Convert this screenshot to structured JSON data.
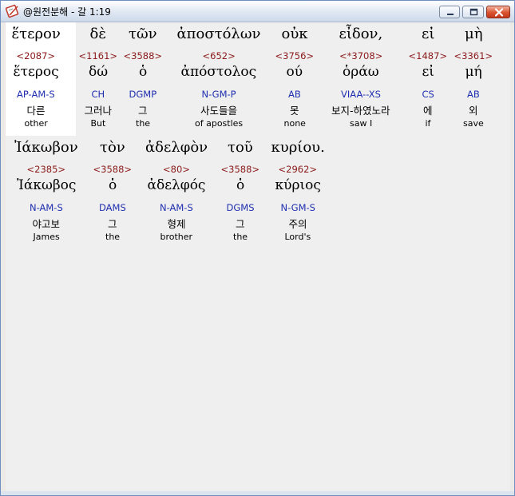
{
  "window": {
    "title": "@원전분해 - 갈 1:19",
    "icon": "book-pen-icon",
    "buttons": [
      "minimize-icon",
      "maximize-icon",
      "close-icon"
    ]
  },
  "lines": [
    {
      "words": [
        {
          "greek": "ἕτερον",
          "strong": "<2087>",
          "lemma": "ἕτερος",
          "parse": "AP-AM-S",
          "korean": "다른",
          "english": "other",
          "highlight": true
        },
        {
          "greek": "δὲ",
          "strong": "<1161>",
          "lemma": "δώ",
          "parse": "CH",
          "korean": "그러나",
          "english": "But"
        },
        {
          "greek": "τῶν",
          "strong": "<3588>",
          "lemma": "ὁ",
          "parse": "DGMP",
          "korean": "그",
          "english": "the"
        },
        {
          "greek": "ἀποστόλων",
          "strong": "<652>",
          "lemma": "ἀπόστολος",
          "parse": "N-GM-P",
          "korean": "사도들을",
          "english": "of apostles"
        },
        {
          "greek": "οὐκ",
          "strong": "<3756>",
          "lemma": "ού",
          "parse": "AB",
          "korean": "못",
          "english": "none"
        },
        {
          "greek": "εἶδον,",
          "strong": "<*3708>",
          "lemma": "ὁράω",
          "parse": "VIAA--XS",
          "korean": "보지-하였노라",
          "english": "saw I"
        },
        {
          "greek": "εἰ",
          "strong": "<1487>",
          "lemma": "εἰ",
          "parse": "CS",
          "korean": "에",
          "english": "if"
        },
        {
          "greek": "μὴ",
          "strong": "<3361>",
          "lemma": "μή",
          "parse": "AB",
          "korean": "외",
          "english": "save"
        }
      ]
    },
    {
      "words": [
        {
          "greek": "Ἰάκωβον",
          "strong": "<2385>",
          "lemma": "Ἰάκωβος",
          "parse": "N-AM-S",
          "korean": "야고보",
          "english": "James"
        },
        {
          "greek": "τὸν",
          "strong": "<3588>",
          "lemma": "ὁ",
          "parse": "DAMS",
          "korean": "그",
          "english": "the"
        },
        {
          "greek": "ἀδελφὸν",
          "strong": "<80>",
          "lemma": "ἀδελφός",
          "parse": "N-AM-S",
          "korean": "형제",
          "english": "brother"
        },
        {
          "greek": "τοῦ",
          "strong": "<3588>",
          "lemma": "ὁ",
          "parse": "DGMS",
          "korean": "그",
          "english": "the"
        },
        {
          "greek": "κυρίου.",
          "strong": "<2962>",
          "lemma": "κύριος",
          "parse": "N-GM-S",
          "korean": "주의",
          "english": "Lord's"
        }
      ]
    }
  ],
  "colors": {
    "strong": "#8b1a1a",
    "parse": "#1f2fb0",
    "text": "#000000",
    "background": "#efefef",
    "highlight": "#ffffff"
  }
}
